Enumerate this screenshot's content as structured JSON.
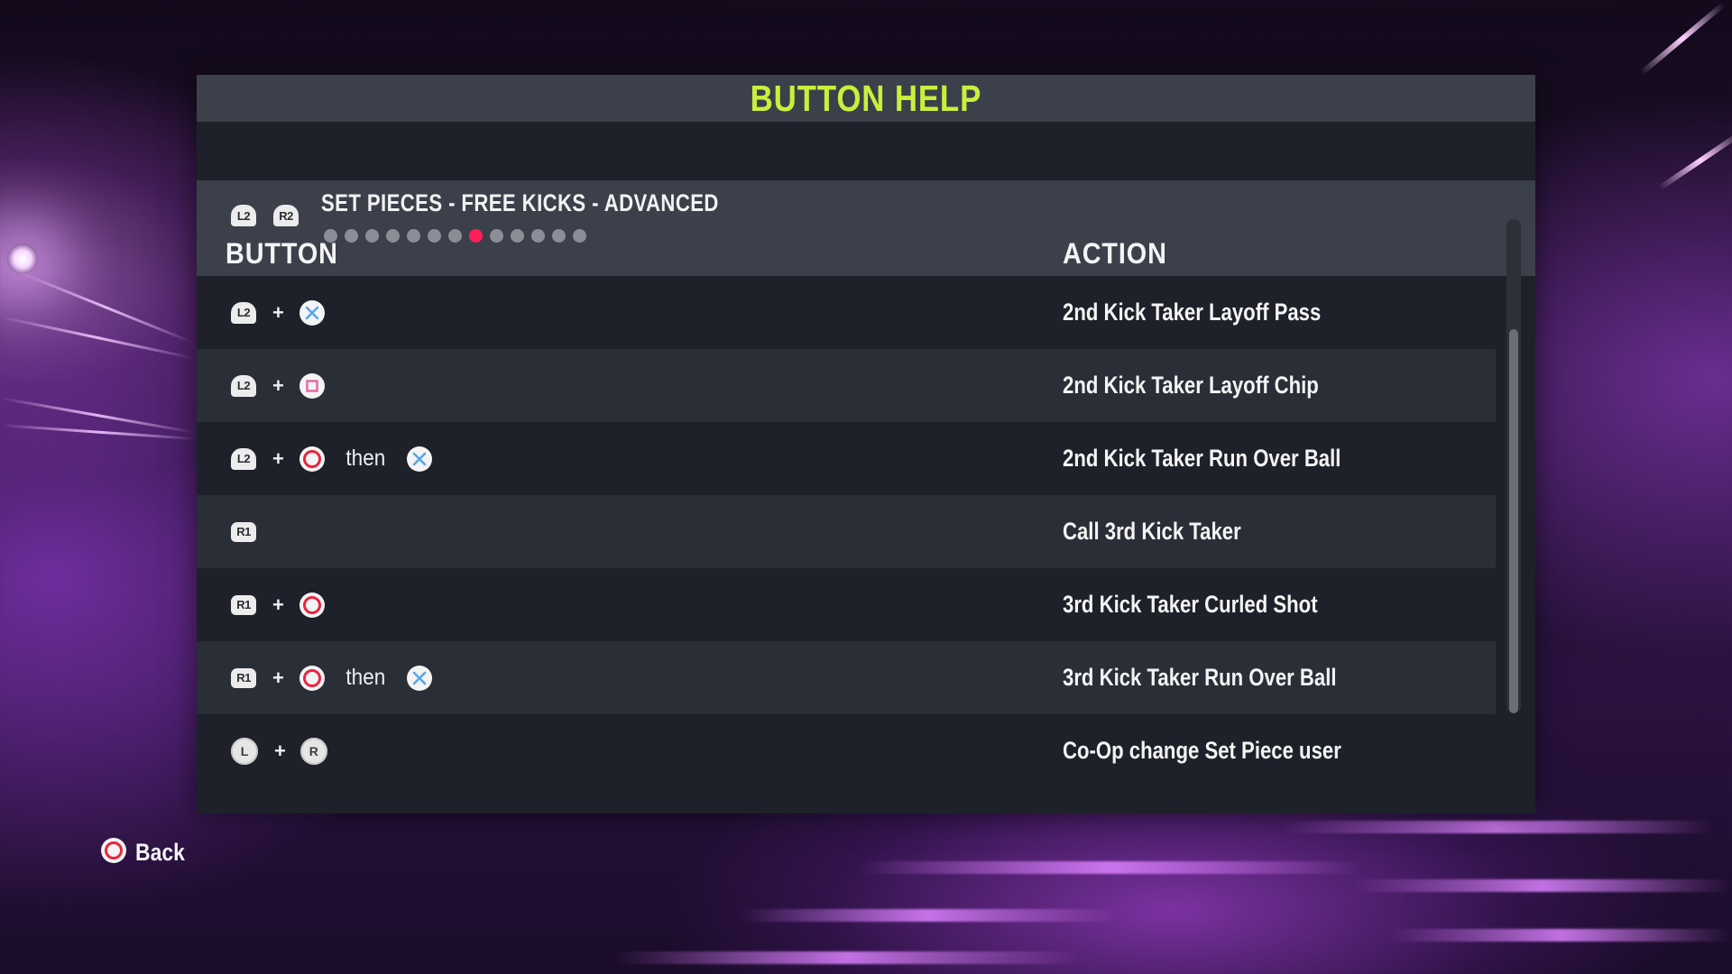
{
  "header": {
    "title": "BUTTON HELP"
  },
  "section": {
    "prev_button": "L2",
    "next_button": "R2",
    "title": "SET PIECES - FREE KICKS - ADVANCED",
    "page_count": 13,
    "active_page": 8
  },
  "columns": {
    "button": "BUTTON",
    "action": "ACTION"
  },
  "rows": [
    {
      "action": "2nd Kick Taker Layoff Pass",
      "b1": "L2",
      "b2": "cross",
      "then": "",
      "b3": ""
    },
    {
      "action": "2nd Kick Taker Layoff Chip",
      "b1": "L2",
      "b2": "square",
      "then": "",
      "b3": ""
    },
    {
      "action": "2nd Kick Taker Run Over Ball",
      "b1": "L2",
      "b2": "circle",
      "then": "then",
      "b3": "cross"
    },
    {
      "action": "Call 3rd Kick Taker",
      "b1": "R1",
      "b2": "",
      "then": "",
      "b3": ""
    },
    {
      "action": "3rd Kick Taker Curled Shot",
      "b1": "R1",
      "b2": "circle",
      "then": "",
      "b3": ""
    },
    {
      "action": "3rd Kick Taker Run Over Ball",
      "b1": "R1",
      "b2": "circle",
      "then": "then",
      "b3": "cross"
    },
    {
      "action": "Co-Op change Set Piece user",
      "b1": "L",
      "b2": "R",
      "then": "",
      "b3": ""
    }
  ],
  "plus_label": "+",
  "footer": {
    "back_label": "Back",
    "back_button": "circle"
  },
  "colors": {
    "title": "#c8f03c",
    "active_dot": "#ff1f58",
    "circle": "#e8273f",
    "cross": "#5aa7e6",
    "square": "#e36fa7"
  }
}
